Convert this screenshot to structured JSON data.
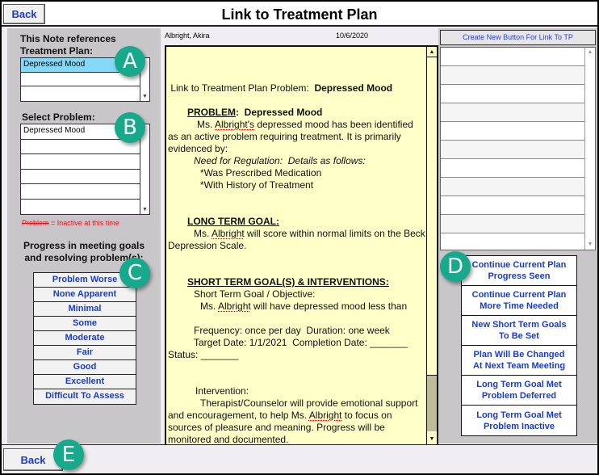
{
  "header": {
    "title": "Link to Treatment Plan",
    "back_label": "Back"
  },
  "left_panel": {
    "treatment_plan_label_line1": "This Note references",
    "treatment_plan_label_line2": "Treatment Plan:",
    "treatment_plan_items": [
      "Depressed Mood",
      "",
      ""
    ],
    "treatment_plan_selected": "Depressed Mood",
    "select_problem_label": "Select Problem:",
    "problem_items": [
      "Depressed Mood",
      "",
      "",
      "",
      "",
      ""
    ],
    "inactive_note_struck": "Problem",
    "inactive_note_rest": " = Inactive at this time",
    "progress_label_line1": "Progress in meeting goals",
    "progress_label_line2": "and resolving problem(s):",
    "progress_options": [
      "Problem Worse",
      "None Apparent",
      "Minimal",
      "Some",
      "Moderate",
      "Fair",
      "Good",
      "Excellent",
      "Difficult To Assess"
    ]
  },
  "center": {
    "patient_name": "Albright, Akira",
    "date": "10/6/2020",
    "note": {
      "link_prefix": " Link to Treatment Plan Problem:  ",
      "link_problem": "Depressed Mood",
      "problem_heading": "PROBLEM",
      "problem_name": "Depressed Mood",
      "problem_text_pre": "Ms. ",
      "patient_possessive": "Albright's",
      "problem_text_post": " depressed mood has been identified as an active problem requiring treatment. It is primarily evidenced by:",
      "regulation_line": "Need for Regulation:  Details as follows:",
      "detail_1": "*Was Prescribed Medication",
      "detail_2": "*With History of Treatment",
      "ltg_heading": "LONG TERM GOAL",
      "ltg_pre": "Ms. ",
      "patient_last": "Albright",
      "ltg_post": " will score within normal limits on the Beck Depression Scale.",
      "stg_heading": "SHORT TERM GOAL(S) & INTERVENTIONS:",
      "stg_objective_label": "Short Term Goal / Objective:",
      "stg_pre": "Ms. ",
      "stg_post": " will have depressed mood less than",
      "frequency_line": "Frequency: once per day  Duration: one week",
      "target_line": "Target Date: 1/1/2021  Completion Date: _______",
      "status_line": "Status: _______",
      "intervention_label": "Intervention:",
      "intervention_pre": "Therapist/Counselor will provide emotional support and encouragement, to help Ms. ",
      "intervention_post": " to focus on sources of pleasure and meaning. Progress will be monitored and documented."
    }
  },
  "right_panel": {
    "create_button_label": "Create New Button For Link To TP",
    "list_rows": [
      "",
      "",
      "",
      "",
      "",
      "",
      "",
      "",
      "",
      "",
      ""
    ],
    "decision_buttons": [
      {
        "line1": "Continue Current Plan",
        "line2": "Progress Seen"
      },
      {
        "line1": "Continue Current Plan",
        "line2": "More Time Needed"
      },
      {
        "line1": "New Short Term Goals",
        "line2": "To Be Set"
      },
      {
        "line1": "Plan Will Be Changed",
        "line2": "At Next Team Meeting"
      },
      {
        "line1": "Long Term Goal Met",
        "line2": "Problem Deferred"
      },
      {
        "line1": "Long Term Goal Met",
        "line2": "Problem Inactive"
      }
    ]
  },
  "footer": {
    "back_label": "Back"
  },
  "callouts": [
    "A",
    "B",
    "C",
    "D",
    "E"
  ],
  "colors": {
    "accent_text": "#1a3ccc",
    "badge": "#17a98b",
    "note_background": "#ffffc8",
    "selected_row": "#86d8f6",
    "inactive_red": "#e0141e"
  }
}
